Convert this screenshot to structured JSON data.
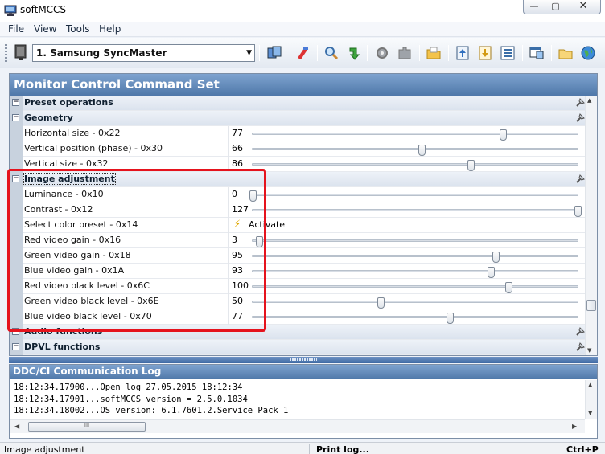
{
  "window": {
    "title": "softMCCS",
    "min_label": "—",
    "max_label": "▢",
    "close_label": "✕"
  },
  "menu": {
    "file": "File",
    "view": "View",
    "tools": "Tools",
    "help": "Help"
  },
  "toolbar": {
    "monitor_select": "1. Samsung SyncMaster"
  },
  "main_panel": {
    "header": "Monitor Control Command Set",
    "groups": {
      "preset": {
        "label": "Preset operations"
      },
      "geometry": {
        "label": "Geometry",
        "items": [
          {
            "label": "Horizontal size - 0x22",
            "value": "77",
            "level": 0.77
          },
          {
            "label": "Vertical position (phase) - 0x30",
            "value": "66",
            "level": 0.52
          },
          {
            "label": "Vertical size - 0x32",
            "value": "86",
            "level": 0.67
          }
        ]
      },
      "image": {
        "label": "Image adjustment",
        "items": [
          {
            "label": "Luminance - 0x10",
            "value": "0",
            "level": 0.0
          },
          {
            "label": "Contrast - 0x12",
            "value": "127",
            "level": 1.0
          },
          {
            "label": "Select color preset - 0x14",
            "value": "Activate"
          },
          {
            "label": "Red video gain - 0x16",
            "value": "3",
            "level": 0.02
          },
          {
            "label": "Green video gain - 0x18",
            "value": "95",
            "level": 0.748
          },
          {
            "label": "Blue video gain - 0x1A",
            "value": "93",
            "level": 0.732
          },
          {
            "label": "Red video black level - 0x6C",
            "value": "100",
            "level": 0.787
          },
          {
            "label": "Green video black level - 0x6E",
            "value": "50",
            "level": 0.394
          },
          {
            "label": "Blue video black level - 0x70",
            "value": "77",
            "level": 0.606
          }
        ]
      },
      "audio": {
        "label": "Audio functions"
      },
      "dpvl": {
        "label": "DPVL functions"
      }
    }
  },
  "log_panel": {
    "header": "DDC/CI Communication Log",
    "lines": [
      "18:12:34.17900...Open log 27.05.2015 18:12:34",
      "18:12:34.17901...softMCCS version = 2.5.0.1034",
      "18:12:34.18002...OS version: 6.1.7601.2.Service Pack 1"
    ],
    "hscroll_thumb": "III"
  },
  "status": {
    "left": "Image adjustment",
    "middle": "Print log...",
    "right": "Ctrl+P"
  },
  "colors": {
    "header": "#4f78a9",
    "highlight": "#e5131d",
    "bolt": "#e0a800"
  }
}
